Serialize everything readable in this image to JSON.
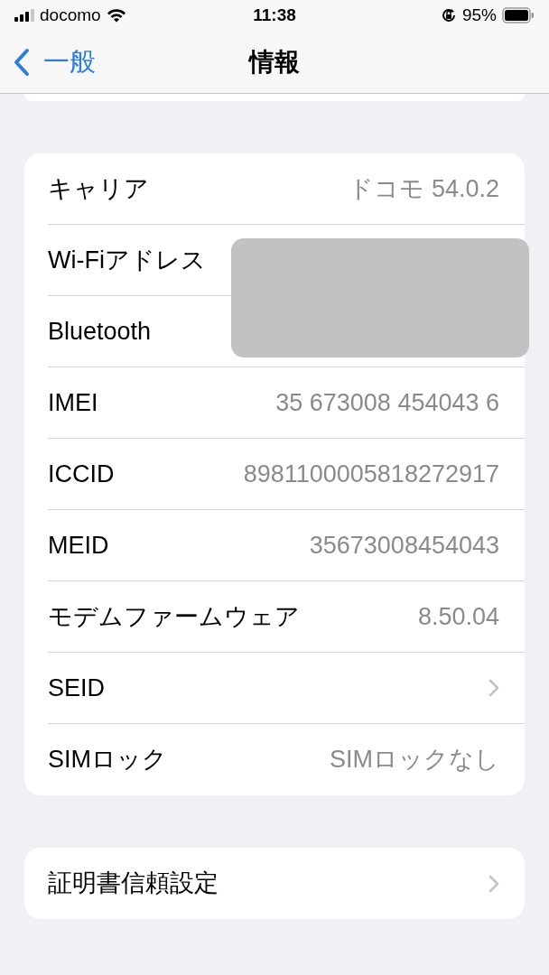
{
  "status_bar": {
    "carrier": "docomo",
    "time": "11:38",
    "battery": "95%"
  },
  "nav": {
    "back": "一般",
    "title": "情報"
  },
  "info_rows": [
    {
      "kind": "value",
      "label": "キャリア",
      "value": "ドコモ 54.0.2"
    },
    {
      "kind": "hidden",
      "label": "Wi-Fiアドレス"
    },
    {
      "kind": "hidden",
      "label": "Bluetooth"
    },
    {
      "kind": "value",
      "label": "IMEI",
      "value": "35 673008 454043 6"
    },
    {
      "kind": "value",
      "label": "ICCID",
      "value": "8981100005818272917"
    },
    {
      "kind": "value",
      "label": "MEID",
      "value": "35673008454043"
    },
    {
      "kind": "value",
      "label": "モデムファームウェア",
      "value": "8.50.04"
    },
    {
      "kind": "link",
      "label": "SEID"
    },
    {
      "kind": "value",
      "label": "SIMロック",
      "value": "SIMロックなし"
    }
  ],
  "extra_rows": [
    {
      "kind": "link",
      "label": "証明書信頼設定"
    }
  ]
}
